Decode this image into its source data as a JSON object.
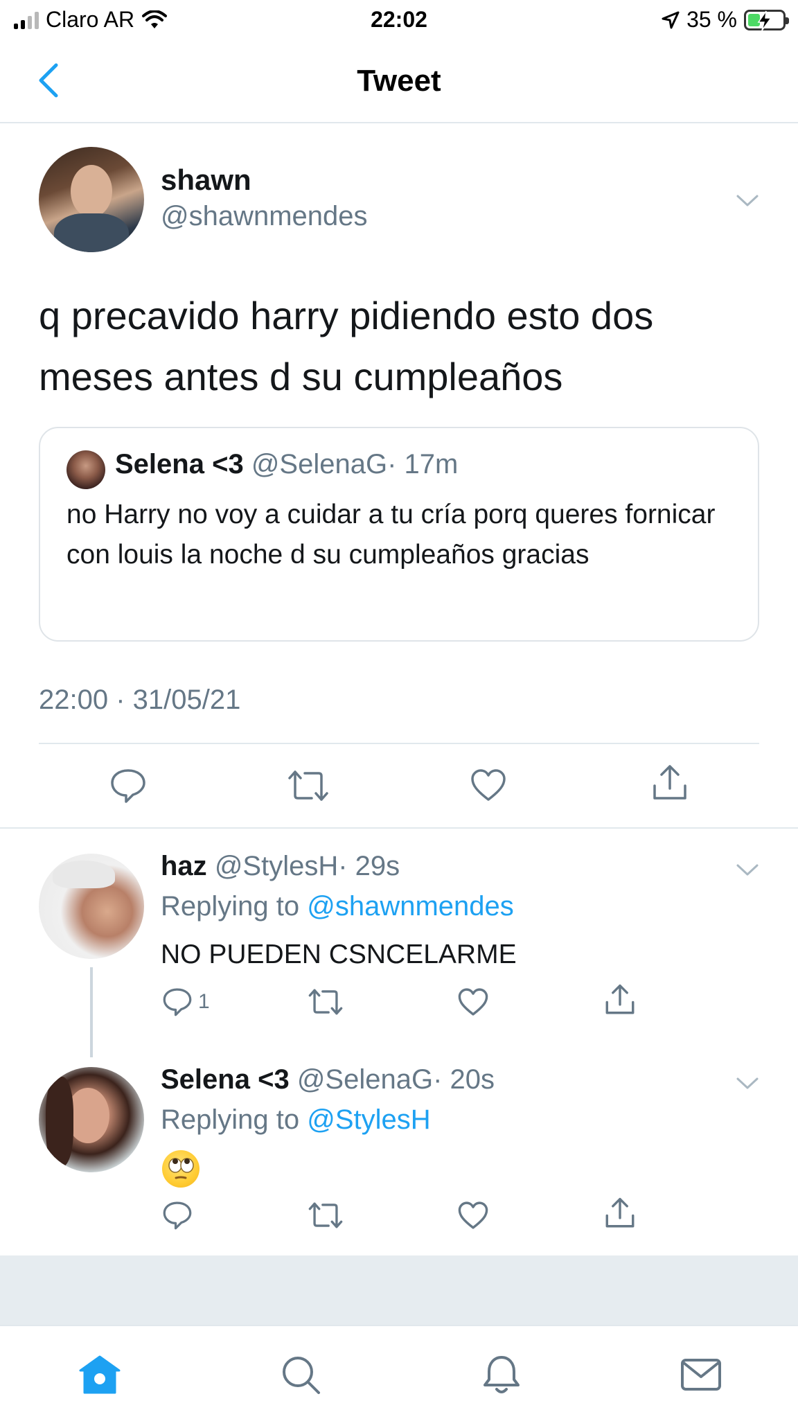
{
  "status_bar": {
    "carrier": "Claro AR",
    "time": "22:02",
    "battery_percent": "35 %",
    "battery_level": 0.35
  },
  "nav": {
    "title": "Tweet",
    "back_icon": "chevron-left-icon"
  },
  "main_tweet": {
    "name": "shawn",
    "handle": "@shawnmendes",
    "text": "q precavido harry pidiendo esto dos meses antes d su cumpleaños",
    "quote": {
      "name": "Selena <3",
      "handle": "@SelenaG",
      "time": "· 17m",
      "text": "no Harry no voy a cuidar a tu cría porq queres fornicar con louis la noche d su cumpleaños gracias"
    },
    "timestamp": "22:00 · 31/05/21"
  },
  "replies": [
    {
      "name": "haz",
      "handle": "@StylesH",
      "time": "· 29s",
      "replying_prefix": "Replying to",
      "replying_to": "@shawnmendes",
      "text": "NO PUEDEN CSNCELARME",
      "reply_count": "1"
    },
    {
      "name": "Selena <3",
      "handle": "@SelenaG",
      "time": "· 20s",
      "replying_prefix": "Replying to",
      "replying_to": "@StylesH",
      "emoji": "face-with-rolling-eyes-icon"
    }
  ],
  "tab_bar": {
    "items": [
      "home-icon",
      "search-icon",
      "notifications-icon",
      "messages-icon"
    ]
  },
  "colors": {
    "accent": "#1da1f2",
    "secondary_text": "#657786",
    "divider": "#e1e8ed"
  }
}
